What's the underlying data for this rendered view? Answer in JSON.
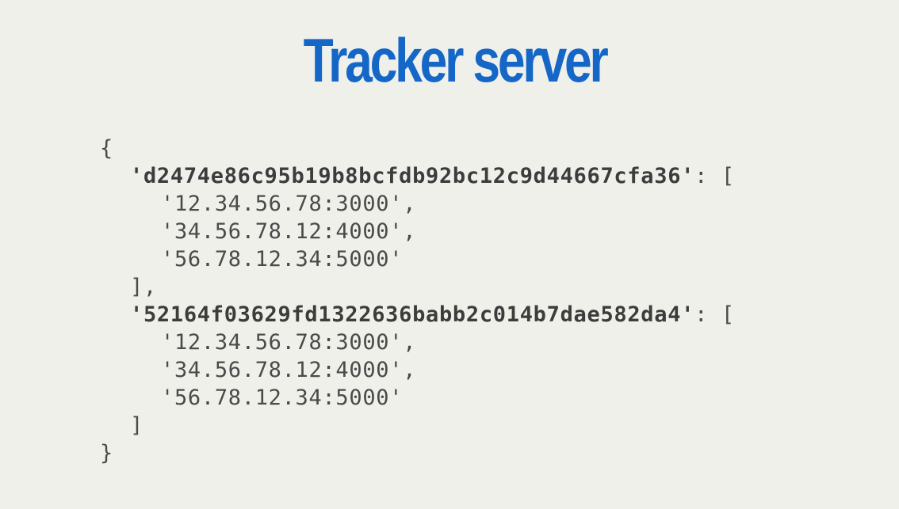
{
  "slide": {
    "title": "Tracker server"
  },
  "code": {
    "open_brace": "{",
    "close_brace": "}",
    "entries": [
      {
        "key": "'d2474e86c95b19b8bcfdb92bc12c9d44667cfa36'",
        "key_suffix": ": [",
        "peers": [
          "'12.34.56.78:3000',",
          "'34.56.78.12:4000',",
          "'56.78.12.34:5000'"
        ],
        "close": "],"
      },
      {
        "key": "'52164f03629fd1322636babb2c014b7dae582da4'",
        "key_suffix": ": [",
        "peers": [
          "'12.34.56.78:3000',",
          "'34.56.78.12:4000',",
          "'56.78.12.34:5000'"
        ],
        "close": "]"
      }
    ]
  }
}
